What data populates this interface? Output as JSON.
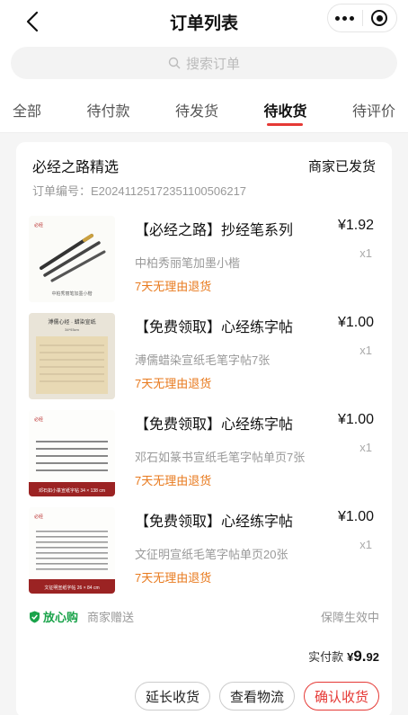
{
  "header": {
    "title": "订单列表"
  },
  "search": {
    "placeholder": "搜索订单"
  },
  "tabs": [
    {
      "label": "全部"
    },
    {
      "label": "待付款"
    },
    {
      "label": "待发货"
    },
    {
      "label": "待收货",
      "active": true
    },
    {
      "label": "待评价"
    }
  ],
  "order": {
    "shop_name": "必经之路精选",
    "status": "商家已发货",
    "order_no": "订单编号：E20241125172351100506217",
    "items": [
      {
        "name": "【必经之路】抄经笔系列",
        "price": "¥1.92",
        "qty": "x1",
        "spec": "中柏秀丽笔加墨小楷",
        "return_policy": "7天无理由退货",
        "thumb_caption": "中柏秀丽笔加墨小楷"
      },
      {
        "name": "【免费领取】心经练字帖",
        "price": "¥1.00",
        "qty": "x1",
        "spec": "溥儒蜡染宣纸毛笔字帖7张",
        "return_policy": "7天无理由退货",
        "thumb_caption": "溥儒心经 · 蜡染宣纸",
        "thumb_sub": "34*93cm"
      },
      {
        "name": "【免费领取】心经练字帖",
        "price": "¥1.00",
        "qty": "x1",
        "spec": "邓石如篆书宣纸毛笔字帖单页7张",
        "return_policy": "7天无理由退货",
        "thumb_caption": "邓石如小篆宣纸字帖 34 × 138 cm"
      },
      {
        "name": "【免费领取】心经练字帖",
        "price": "¥1.00",
        "qty": "x1",
        "spec": "文征明宣纸毛笔字帖单页20张",
        "return_policy": "7天无理由退货",
        "thumb_caption": "文征明宣纸字帖 26 × 84 cm"
      }
    ],
    "guarantee_label": "放心购",
    "gift_note": "商家赠送",
    "guarantee_status": "保障生效中",
    "paid_label": "实付款",
    "paid_currency": "¥",
    "paid_int": "9.",
    "paid_dec": "92",
    "actions": {
      "extend": "延长收货",
      "logistics": "查看物流",
      "confirm": "确认收货"
    }
  },
  "colors": {
    "accent": "#e53935",
    "guarantee": "#1aa34a",
    "return_policy": "#e87a1e"
  }
}
